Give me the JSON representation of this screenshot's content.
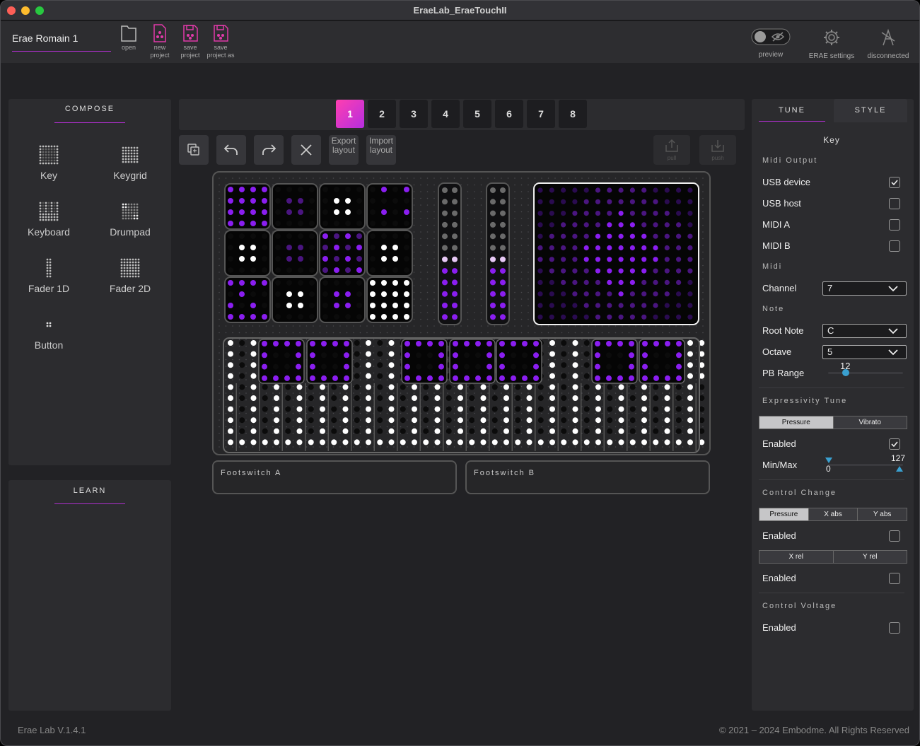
{
  "window": {
    "title": "EraeLab_EraeTouchII"
  },
  "toolbar": {
    "project_name": "Erae Romain 1",
    "open": "open",
    "new_project": [
      "new",
      "project"
    ],
    "save_project": [
      "save",
      "project"
    ],
    "save_project_as": [
      "save",
      "project as"
    ],
    "preview": "preview",
    "erae_settings": "ERAE settings",
    "status": "disconnected"
  },
  "compose": {
    "title": "COMPOSE",
    "items": [
      {
        "label": "Key",
        "icon": "key-grid-icon"
      },
      {
        "label": "Keygrid",
        "icon": "keygrid-icon"
      },
      {
        "label": "Keyboard",
        "icon": "keyboard-icon"
      },
      {
        "label": "Drumpad",
        "icon": "drumpad-icon"
      },
      {
        "label": "Fader 1D",
        "icon": "fader-1d-icon"
      },
      {
        "label": "Fader 2D",
        "icon": "fader-2d-icon"
      },
      {
        "label": "Button",
        "icon": "button-icon"
      }
    ]
  },
  "learn": {
    "title": "LEARN"
  },
  "pages": {
    "tabs": [
      "1",
      "2",
      "3",
      "4",
      "5",
      "6",
      "7",
      "8"
    ],
    "active": "1"
  },
  "layout_tools": {
    "export": [
      "Export",
      "layout"
    ],
    "import": [
      "Import",
      "layout"
    ],
    "pull": "pull",
    "push": "push"
  },
  "footswitches": {
    "a": "Footswitch A",
    "b": "Footswitch B"
  },
  "right_panel": {
    "tabs": [
      "TUNE",
      "STYLE"
    ],
    "active_tab": "TUNE",
    "heading": "Key",
    "midi_output_title": "Midi Output",
    "outputs": [
      {
        "label": "USB device",
        "checked": true
      },
      {
        "label": "USB host",
        "checked": false
      },
      {
        "label": "MIDI A",
        "checked": false
      },
      {
        "label": "MIDI B",
        "checked": false
      }
    ],
    "midi_title": "Midi",
    "channel_label": "Channel",
    "channel_value": "7",
    "note_title": "Note",
    "root_note_label": "Root Note",
    "root_note_value": "C",
    "octave_label": "Octave",
    "octave_value": "5",
    "pb_range_label": "PB Range",
    "pb_range_value": "12",
    "expressivity_title": "Expressivity Tune",
    "expressivity_tabs": [
      "Pressure",
      "Vibrato"
    ],
    "expressivity_enabled_label": "Enabled",
    "expressivity_enabled": true,
    "minmax_label": "Min/Max",
    "min_value": "0",
    "max_value": "127",
    "cc_title": "Control Change",
    "cc_tabs": [
      "Pressure",
      "X abs",
      "Y abs"
    ],
    "cc_enabled_label": "Enabled",
    "cc_rel_tabs": [
      "X rel",
      "Y rel"
    ],
    "cc_rel_enabled_label": "Enabled",
    "cv_title": "Control Voltage",
    "cv_enabled_label": "Enabled"
  },
  "footer": {
    "version": "Erae Lab V.1.4.1",
    "copyright": "© 2021 – 2024 Embodme. All Rights Reserved"
  },
  "colors": {
    "accent": "#b02fd0",
    "purple": "#8a1ef0",
    "pink": "#ff3fb0"
  }
}
